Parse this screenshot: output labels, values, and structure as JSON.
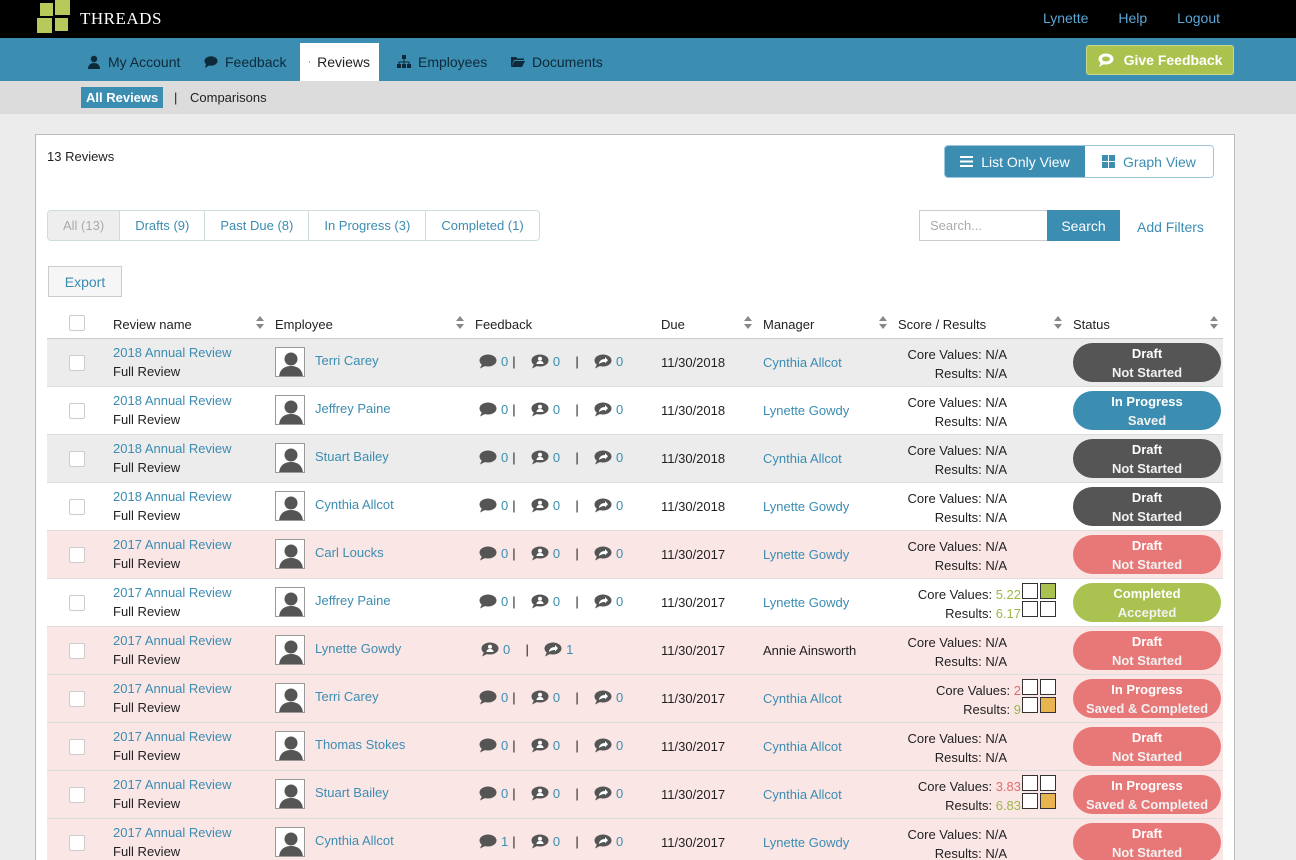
{
  "app": {
    "brand": "THREADS"
  },
  "topbar": {
    "links": [
      "Lynette",
      "Help",
      "Logout"
    ]
  },
  "nav": {
    "items": [
      "My Account",
      "Feedback",
      "Reviews",
      "Employees",
      "Documents"
    ],
    "give_feedback": "Give Feedback"
  },
  "subnav": {
    "all_reviews": "All Reviews",
    "separator": "|",
    "comparisons": "Comparisons"
  },
  "panel": {
    "count": "13 Reviews",
    "view_list": "List Only View",
    "view_graph": "Graph View",
    "filters": [
      "All (13)",
      "Drafts (9)",
      "Past Due (8)",
      "In Progress (3)",
      "Completed (1)"
    ],
    "search_placeholder": "Search...",
    "search_button": "Search",
    "add_filters": "Add Filters",
    "export": "Export"
  },
  "table": {
    "headers": {
      "review_name": "Review name",
      "employee": "Employee",
      "feedback": "Feedback",
      "due": "Due",
      "manager": "Manager",
      "score": "Score / Results",
      "status": "Status"
    },
    "core_label": "Core Values:",
    "results_label": "Results:",
    "rows": [
      {
        "title": "2018 Annual Review",
        "sub": "Full Review",
        "employee": "Terri Carey",
        "fb": [
          "0",
          "0",
          "0"
        ],
        "due": "11/30/2018",
        "manager": "Cynthia Allcot",
        "core": "N/A",
        "results": "N/A",
        "status1": "Draft",
        "status2": "Not Started"
      },
      {
        "title": "2018 Annual Review",
        "sub": "Full Review",
        "employee": "Jeffrey Paine",
        "fb": [
          "0",
          "0",
          "0"
        ],
        "due": "11/30/2018",
        "manager": "Lynette Gowdy",
        "core": "N/A",
        "results": "N/A",
        "status1": "In Progress",
        "status2": "Saved"
      },
      {
        "title": "2018 Annual Review",
        "sub": "Full Review",
        "employee": "Stuart Bailey",
        "fb": [
          "0",
          "0",
          "0"
        ],
        "due": "11/30/2018",
        "manager": "Cynthia Allcot",
        "core": "N/A",
        "results": "N/A",
        "status1": "Draft",
        "status2": "Not Started"
      },
      {
        "title": "2018 Annual Review",
        "sub": "Full Review",
        "employee": "Cynthia Allcot",
        "fb": [
          "0",
          "0",
          "0"
        ],
        "due": "11/30/2018",
        "manager": "Lynette Gowdy",
        "core": "N/A",
        "results": "N/A",
        "status1": "Draft",
        "status2": "Not Started"
      },
      {
        "title": "2017 Annual Review",
        "sub": "Full Review",
        "employee": "Carl Loucks",
        "fb": [
          "0",
          "0",
          "0"
        ],
        "due": "11/30/2017",
        "manager": "Lynette Gowdy",
        "core": "N/A",
        "results": "N/A",
        "status1": "Draft",
        "status2": "Not Started"
      },
      {
        "title": "2017 Annual Review",
        "sub": "Full Review",
        "employee": "Jeffrey Paine",
        "fb": [
          "0",
          "0",
          "0"
        ],
        "due": "11/30/2017",
        "manager": "Lynette Gowdy",
        "core": "5.22",
        "results": "6.17",
        "status1": "Completed",
        "status2": "Accepted"
      },
      {
        "title": "2017 Annual Review",
        "sub": "Full Review",
        "employee": "Lynette Gowdy",
        "fb": [
          "0",
          "1"
        ],
        "due": "11/30/2017",
        "manager": "Annie Ainsworth",
        "core": "N/A",
        "results": "N/A",
        "status1": "Draft",
        "status2": "Not Started"
      },
      {
        "title": "2017 Annual Review",
        "sub": "Full Review",
        "employee": "Terri Carey",
        "fb": [
          "0",
          "0",
          "0"
        ],
        "due": "11/30/2017",
        "manager": "Cynthia Allcot",
        "core": "2",
        "results": "9",
        "status1": "In Progress",
        "status2": "Saved & Completed"
      },
      {
        "title": "2017 Annual Review",
        "sub": "Full Review",
        "employee": "Thomas Stokes",
        "fb": [
          "0",
          "0",
          "0"
        ],
        "due": "11/30/2017",
        "manager": "Cynthia Allcot",
        "core": "N/A",
        "results": "N/A",
        "status1": "Draft",
        "status2": "Not Started"
      },
      {
        "title": "2017 Annual Review",
        "sub": "Full Review",
        "employee": "Stuart Bailey",
        "fb": [
          "0",
          "0",
          "0"
        ],
        "due": "11/30/2017",
        "manager": "Cynthia Allcot",
        "core": "3.83",
        "results": "6.83",
        "status1": "In Progress",
        "status2": "Saved & Completed"
      },
      {
        "title": "2017 Annual Review",
        "sub": "Full Review",
        "employee": "Cynthia Allcot",
        "fb": [
          "1",
          "0",
          "0"
        ],
        "due": "11/30/2017",
        "manager": "Lynette Gowdy",
        "core": "N/A",
        "results": "N/A",
        "status1": "Draft",
        "status2": "Not Started"
      }
    ]
  },
  "colors": {
    "accent": "#3b8db1",
    "green": "#a9c250",
    "red": "#e87878",
    "dark": "#555555",
    "overdue_row": "#fbe6e6"
  }
}
